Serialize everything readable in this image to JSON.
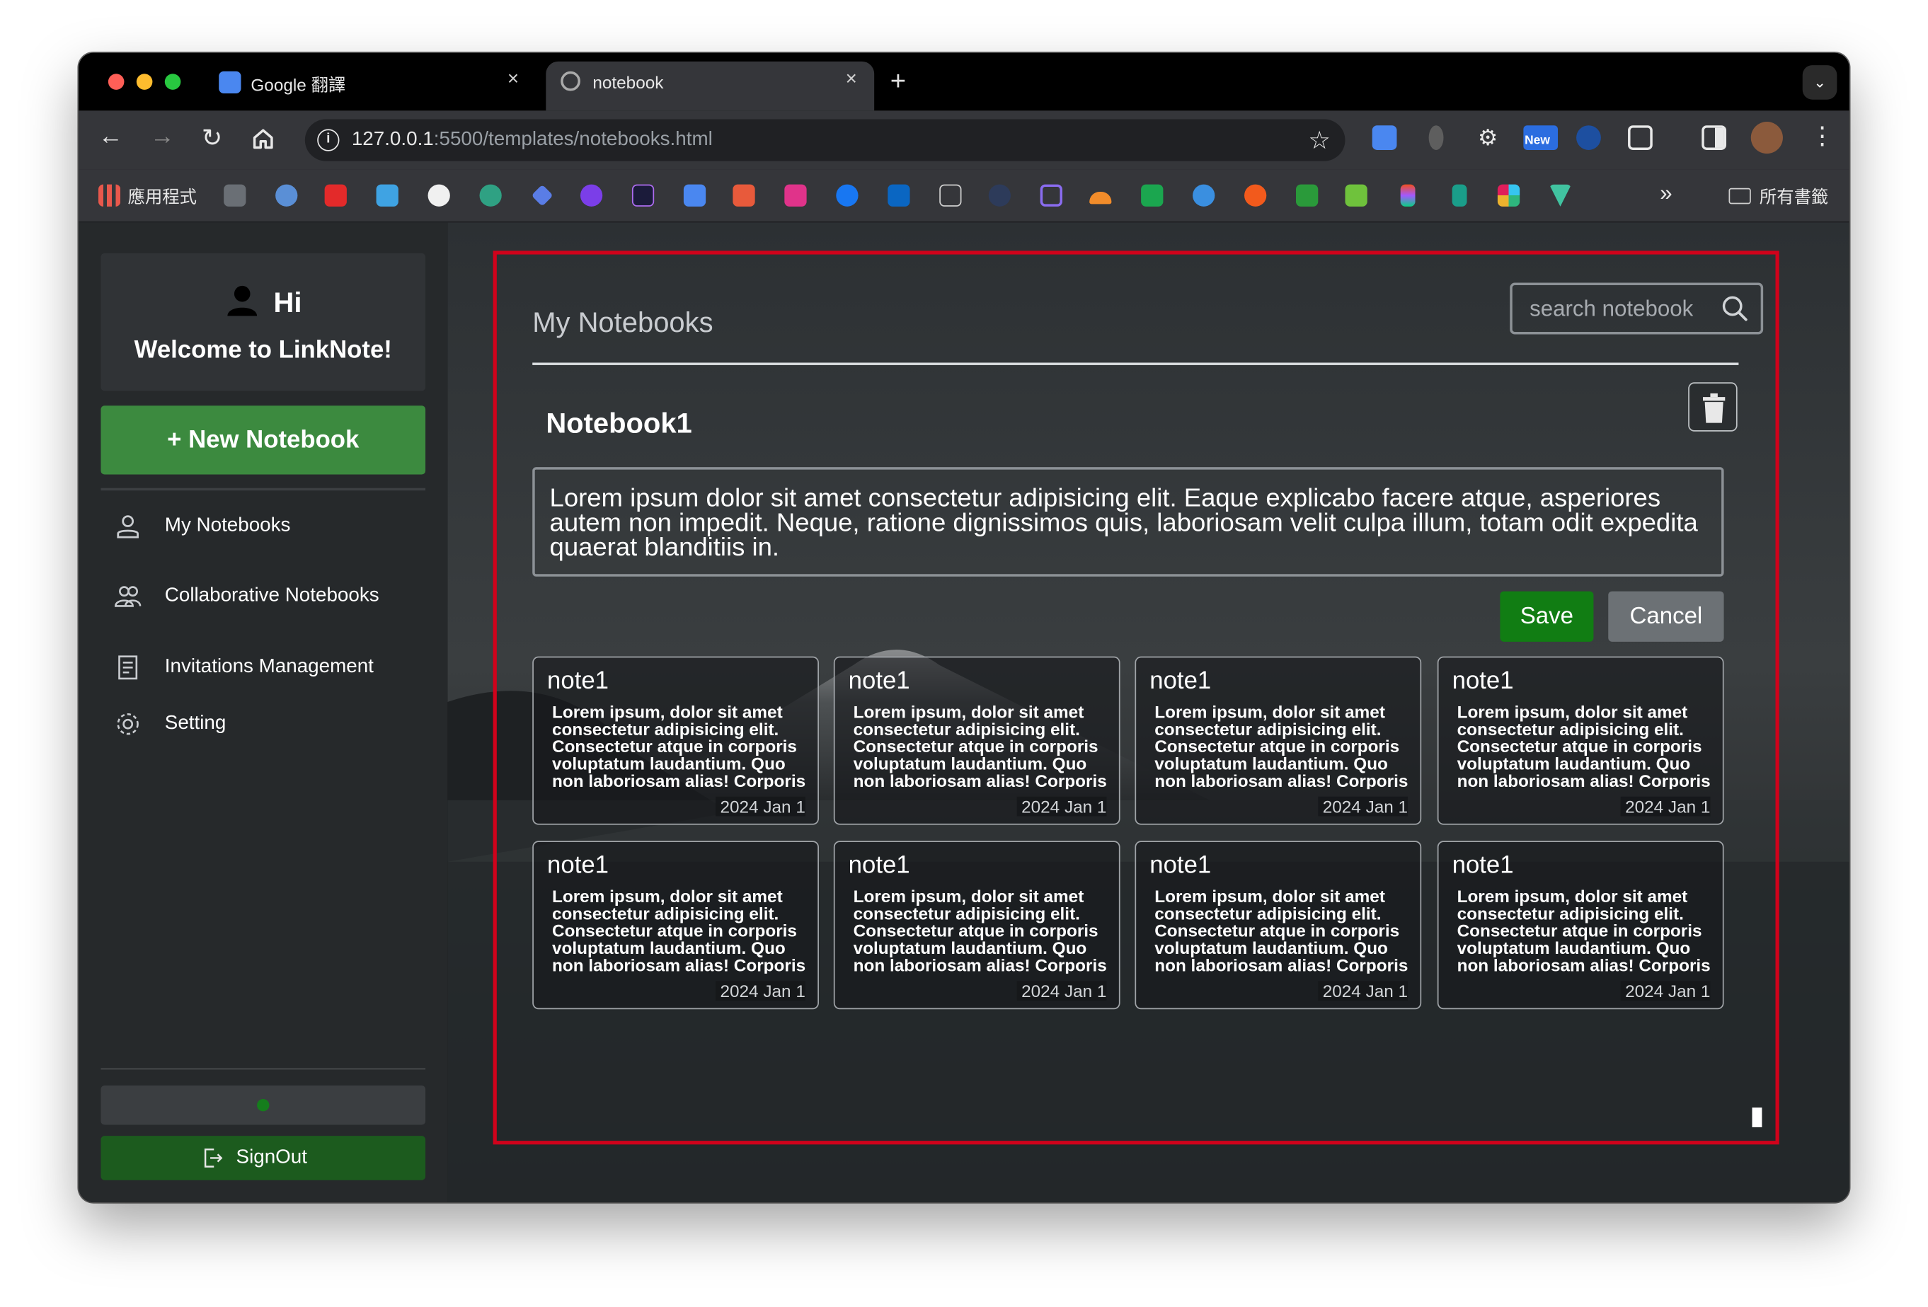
{
  "browser": {
    "tabs": [
      {
        "title": "Google 翻譯",
        "close": "×"
      },
      {
        "title": "notebook",
        "close": "×"
      }
    ],
    "new_tab": "+",
    "tab_menu": "⌄",
    "url_host": "127.0.0.1",
    "url_path": ":5500/templates/notebooks.html",
    "new_badge": "New",
    "bookmarks_apps": "應用程式",
    "bookmarks_more": "»",
    "bookmarks_folder": "所有書籤"
  },
  "sidebar": {
    "greeting": "Hi",
    "welcome": "Welcome to LinkNote!",
    "new_notebook": "+ New Notebook",
    "nav": [
      {
        "label": "My Notebooks",
        "icon": "user-icon"
      },
      {
        "label": "Collaborative Notebooks",
        "icon": "users-icon"
      },
      {
        "label": "Invitations Management",
        "icon": "document-icon"
      },
      {
        "label": "Setting",
        "icon": "gear-icon"
      }
    ],
    "signout": "SignOut",
    "status_color": "#157d1c"
  },
  "main": {
    "title": "My Notebooks",
    "search_placeholder": "search notebook",
    "notebook_title": "Notebook1",
    "notebook_description": "Lorem ipsum dolor sit amet consectetur adipisicing elit. Eaque explicabo facere atque, asperiores autem non impedit. Neque, ratione dignissimos quis, laboriosam velit culpa illum, totam odit expedita quaerat blanditiis in.",
    "save": "Save",
    "cancel": "Cancel",
    "notes": [
      {
        "title": "note1",
        "body": "Lorem ipsum, dolor sit amet consectetur adipisicing elit. Consectetur atque in corporis voluptatum laudantium. Quo non laboriosam alias! Corporis earum obcaecati tempore",
        "date": "2024 Jan 1"
      },
      {
        "title": "note1",
        "body": "Lorem ipsum, dolor sit amet consectetur adipisicing elit. Consectetur atque in corporis voluptatum laudantium. Quo non laboriosam alias! Corporis earum obcaecati tempore",
        "date": "2024 Jan 1"
      },
      {
        "title": "note1",
        "body": "Lorem ipsum, dolor sit amet consectetur adipisicing elit. Consectetur atque in corporis voluptatum laudantium. Quo non laboriosam alias! Corporis earum obcaecati tempore",
        "date": "2024 Jan 1"
      },
      {
        "title": "note1",
        "body": "Lorem ipsum, dolor sit amet consectetur adipisicing elit. Consectetur atque in corporis voluptatum laudantium. Quo non laboriosam alias! Corporis earum obcaecati tempore",
        "date": "2024 Jan 1"
      },
      {
        "title": "note1",
        "body": "Lorem ipsum, dolor sit amet consectetur adipisicing elit. Consectetur atque in corporis voluptatum laudantium. Quo non laboriosam alias! Corporis earum obcaecati tempore",
        "date": "2024 Jan 1"
      },
      {
        "title": "note1",
        "body": "Lorem ipsum, dolor sit amet consectetur adipisicing elit. Consectetur atque in corporis voluptatum laudantium. Quo non laboriosam alias! Corporis earum obcaecati tempore",
        "date": "2024 Jan 1"
      },
      {
        "title": "note1",
        "body": "Lorem ipsum, dolor sit amet consectetur adipisicing elit. Consectetur atque in corporis voluptatum laudantium. Quo non laboriosam alias! Corporis earum obcaecati tempore",
        "date": "2024 Jan 1"
      },
      {
        "title": "note1",
        "body": "Lorem ipsum, dolor sit amet consectetur adipisicing elit. Consectetur atque in corporis voluptatum laudantium. Quo non laboriosam alias! Corporis earum obcaecati tempore",
        "date": "2024 Jan 1"
      }
    ]
  },
  "colors": {
    "accent_green": "#3c8a3f",
    "save_green": "#117d13",
    "highlight_red": "#d0021b"
  }
}
